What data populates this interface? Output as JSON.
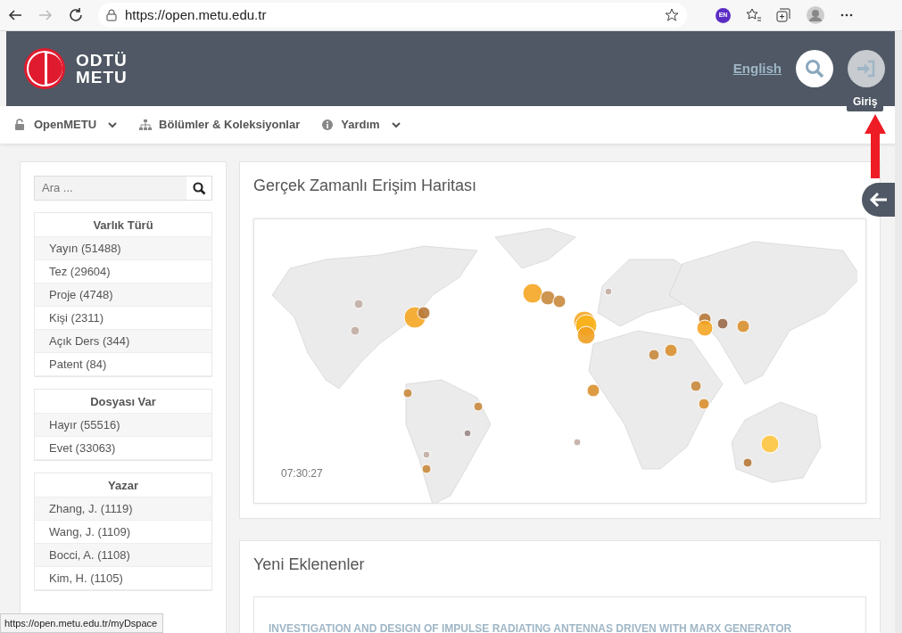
{
  "browser": {
    "url": "https://open.metu.edu.tr",
    "profile_badge": "EN"
  },
  "header": {
    "logo": [
      "ODTÜ",
      "METU"
    ],
    "language": "English",
    "login_tooltip": "Giriş"
  },
  "nav": [
    {
      "label": "OpenMETU",
      "dropdown": true
    },
    {
      "label": "Bölümler & Koleksiyonlar",
      "dropdown": false
    },
    {
      "label": "Yardım",
      "dropdown": true
    }
  ],
  "sidebar": {
    "search": {
      "placeholder": "Ara ..."
    },
    "facets": [
      {
        "title": "Varlık Türü",
        "items": [
          "Yayın (51488)",
          "Tez (29604)",
          "Proje (4748)",
          "Kişi (2311)",
          "Açık Ders (344)",
          "Patent (84)"
        ]
      },
      {
        "title": "Dosyası Var",
        "items": [
          "Hayır (55516)",
          "Evet (33063)"
        ]
      },
      {
        "title": "Yazar",
        "items": [
          "Zhang, J. (1119)",
          "Wang, J. (1109)",
          "Bocci, A. (1108)",
          "Kim, H. (1105)"
        ]
      }
    ]
  },
  "map": {
    "title": "Gerçek Zamanlı Erişim Haritası",
    "time": "07:30:27"
  },
  "recent": {
    "title": "Yeni Eklenenler",
    "items": [
      "INVESTIGATION AND DESIGN OF IMPULSE RADIATING ANTENNAS DRIVEN WITH MARX GENERATOR"
    ]
  },
  "status_bar": "https://open.metu.edu.tr/myDspace"
}
